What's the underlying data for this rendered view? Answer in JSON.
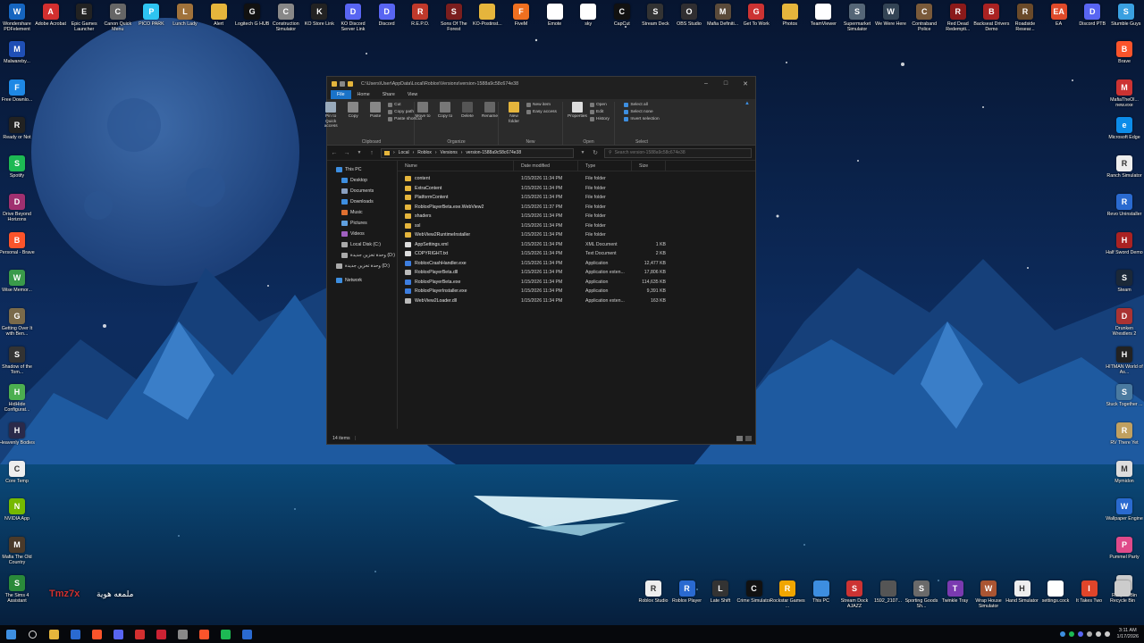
{
  "desktop_icons_top": [
    {
      "label": "Wondershare PDFelement",
      "color": "#1565c0",
      "glyph": "W"
    },
    {
      "label": "Adobe Acrobat",
      "color": "#d32f2f",
      "glyph": "A"
    },
    {
      "label": "Epic Games Launcher",
      "color": "#222222",
      "glyph": "E"
    },
    {
      "label": "Canon Quick Menu",
      "color": "#666666",
      "glyph": "C"
    },
    {
      "label": "PICO PARK",
      "color": "#2ec4f1",
      "glyph": "P"
    },
    {
      "label": "Lunch Lady",
      "color": "#a0723b",
      "glyph": "L"
    },
    {
      "label": "Alert",
      "color": "#e5b53c",
      "glyph": ""
    },
    {
      "label": "Logitech G HUB",
      "color": "#111111",
      "glyph": "G"
    },
    {
      "label": "Construction Simulator",
      "color": "#888888",
      "glyph": "C"
    },
    {
      "label": "KO Store Link",
      "color": "#222222",
      "glyph": "K"
    },
    {
      "label": "KO Discord Server Link",
      "color": "#5865f2",
      "glyph": "D"
    },
    {
      "label": "Discord",
      "color": "#5865f2",
      "glyph": "D"
    },
    {
      "label": "R.E.P.O.",
      "color": "#c0392b",
      "glyph": "R"
    },
    {
      "label": "Sons Of The Forest",
      "color": "#7b1e1e",
      "glyph": "S"
    },
    {
      "label": "KO-Postinst...",
      "color": "#e5b53c",
      "glyph": ""
    },
    {
      "label": "FiveM",
      "color": "#f07020",
      "glyph": "F"
    },
    {
      "label": "Emote",
      "color": "#ffffff",
      "glyph": ""
    },
    {
      "label": "sky",
      "color": "#ffffff",
      "glyph": ""
    },
    {
      "label": "CapCut",
      "color": "#111111",
      "glyph": "C"
    },
    {
      "label": "Stream Deck",
      "color": "#333333",
      "glyph": "S"
    },
    {
      "label": "OBS Studio",
      "color": "#302e31",
      "glyph": "O"
    },
    {
      "label": "Mafia Definiti...",
      "color": "#5a4a3a",
      "glyph": "M"
    },
    {
      "label": "Get To Work",
      "color": "#cc3333",
      "glyph": "G"
    },
    {
      "label": "Photos",
      "color": "#e5b53c",
      "glyph": ""
    },
    {
      "label": "TeamViewer",
      "color": "#ffffff",
      "glyph": ""
    },
    {
      "label": "Supermarket Simulator",
      "color": "#556677",
      "glyph": "S"
    },
    {
      "label": "We Were Here",
      "color": "#334455",
      "glyph": "W"
    },
    {
      "label": "Contraband Police",
      "color": "#7a5a3a",
      "glyph": "C"
    },
    {
      "label": "Red Dead Redempti...",
      "color": "#8b1a1a",
      "glyph": "R"
    },
    {
      "label": "Backseat Drivers Demo",
      "color": "#aa2222",
      "glyph": "B"
    },
    {
      "label": "Roadside Resear...",
      "color": "#6a4a2a",
      "glyph": "R"
    },
    {
      "label": "EA",
      "color": "#e04a2a",
      "glyph": "EA"
    },
    {
      "label": "Discord PTB",
      "color": "#5865f2",
      "glyph": "D"
    },
    {
      "label": "Stumble Guys",
      "color": "#3aa0e0",
      "glyph": "S"
    }
  ],
  "desktop_icons_left": [
    {
      "label": "Malwareby...",
      "color": "#1f4fb5",
      "glyph": "M"
    },
    {
      "label": "Free Downlo...",
      "color": "#1e88e5",
      "glyph": "F"
    },
    {
      "label": "Ready or Not",
      "color": "#222222",
      "glyph": "R"
    },
    {
      "label": "Spotify",
      "color": "#1db954",
      "glyph": "S"
    },
    {
      "label": "Drive Beyond Horizons",
      "color": "#a03070",
      "glyph": "D"
    },
    {
      "label": "Personal - Brave",
      "color": "#fb542b",
      "glyph": "B"
    },
    {
      "label": "Wise Memor...",
      "color": "#3a9a4a",
      "glyph": "W"
    },
    {
      "label": "Getting Over It with Ben...",
      "color": "#7a6a4a",
      "glyph": "G"
    },
    {
      "label": "Shadow of the Tom...",
      "color": "#333333",
      "glyph": "S"
    },
    {
      "label": "HidHide Configurat...",
      "color": "#4caf50",
      "glyph": "H"
    },
    {
      "label": "Heavenly Bodies",
      "color": "#2a2a4a",
      "glyph": "H"
    },
    {
      "label": "Core Temp",
      "color": "#eeeeee",
      "glyph": "C"
    },
    {
      "label": "NVIDIA App",
      "color": "#76b900",
      "glyph": "N"
    },
    {
      "label": "Mafia The Old Country",
      "color": "#4a3a2a",
      "glyph": "M"
    },
    {
      "label": "The Sims 4 Assistant",
      "color": "#2a8a3a",
      "glyph": "S"
    }
  ],
  "desktop_icons_right": [
    {
      "label": "Brave",
      "color": "#fb542b",
      "glyph": "B"
    },
    {
      "label": "MafiaTheOl... new.exe",
      "color": "#cc3333",
      "glyph": "M"
    },
    {
      "label": "Microsoft Edge",
      "color": "#0c8ce9",
      "glyph": "e"
    },
    {
      "label": "Ranch Simulator",
      "color": "#eeeeee",
      "glyph": "R"
    },
    {
      "label": "Revo Uninstaller",
      "color": "#2a6ad0",
      "glyph": "R"
    },
    {
      "label": "Half Sword Demo",
      "color": "#aa2222",
      "glyph": "H"
    },
    {
      "label": "Steam",
      "color": "#1b2838",
      "glyph": "S"
    },
    {
      "label": "Drunken Wrestlers 2",
      "color": "#aa3333",
      "glyph": "D"
    },
    {
      "label": "HITMAN World of As...",
      "color": "#222222",
      "glyph": "H"
    },
    {
      "label": "Stuck Together ...",
      "color": "#4a7aa0",
      "glyph": "S"
    },
    {
      "label": "RV There Yet",
      "color": "#c0a060",
      "glyph": "R"
    },
    {
      "label": "Mymidon",
      "color": "#dddddd",
      "glyph": "M"
    },
    {
      "label": "Wallpaper Engine",
      "color": "#2a6ad0",
      "glyph": "W"
    },
    {
      "label": "Pummel Party",
      "color": "#e04a8a",
      "glyph": "P"
    },
    {
      "label": "Recycle Bin",
      "color": "#cccccc",
      "glyph": ""
    }
  ],
  "desktop_icons_bottom": [
    {
      "label": "Roblox Studio",
      "color": "#eeeeee",
      "glyph": "R"
    },
    {
      "label": "Roblox Player",
      "color": "#2a6ad0",
      "glyph": "R"
    },
    {
      "label": "Late Shift",
      "color": "#333333",
      "glyph": "L"
    },
    {
      "label": "Crime Simulator",
      "color": "#111111",
      "glyph": "C"
    },
    {
      "label": "Rockstar Games ...",
      "color": "#f0a500",
      "glyph": "R"
    },
    {
      "label": "This PC",
      "color": "#3d8ee0",
      "glyph": ""
    },
    {
      "label": "Stream Dock AJAZZ",
      "color": "#cc3333",
      "glyph": "S"
    },
    {
      "label": "1592_2107...",
      "color": "#555555",
      "glyph": ""
    },
    {
      "label": "Sporting Goods Sh...",
      "color": "#6a6a6a",
      "glyph": "S"
    },
    {
      "label": "Twinkle Tray",
      "color": "#7a3ab0",
      "glyph": "T"
    },
    {
      "label": "Wrap House Simulator",
      "color": "#aa5533",
      "glyph": "W"
    },
    {
      "label": "Hand Simulator",
      "color": "#eeeeee",
      "glyph": "H"
    },
    {
      "label": "settings.cock",
      "color": "#ffffff",
      "glyph": ""
    },
    {
      "label": "It Takes Two",
      "color": "#e0452a",
      "glyph": "I"
    },
    {
      "label": "Recycle Bin",
      "color": "#cccccc",
      "glyph": ""
    }
  ],
  "overlay_text": {
    "arabic": "ملمعه هوية",
    "tag": "Tmz7x"
  },
  "explorer": {
    "title_path": "C:\\Users\\User\\AppData\\Local\\Roblox\\Versions\\version-1588a9c58c674e38",
    "tabs": [
      "File",
      "Home",
      "Share",
      "View"
    ],
    "ribbon": {
      "clipboard": {
        "name": "Clipboard",
        "pin": "Pin to Quick access",
        "copy": "Copy",
        "paste": "Paste",
        "cut": "Cut",
        "copy_path": "Copy path",
        "paste_shortcut": "Paste shortcut"
      },
      "organize": {
        "name": "Organize",
        "move": "Move to",
        "copy": "Copy to",
        "delete": "Delete",
        "rename": "Rename"
      },
      "new": {
        "name": "New",
        "folder": "New folder",
        "item": "New item",
        "easy": "Easy access"
      },
      "open": {
        "name": "Open",
        "properties": "Properties",
        "open": "Open",
        "edit": "Edit",
        "history": "History"
      },
      "select": {
        "name": "Select",
        "all": "Select all",
        "none": "Select none",
        "invert": "Invert selection"
      }
    },
    "breadcrumb": [
      "Local",
      "Roblox",
      "Versions",
      "version-1588a9c58c674e38"
    ],
    "search_placeholder": "Search version-1588a9c58c674e38",
    "nav": [
      {
        "label": "This PC",
        "color": "#3d8ee0"
      },
      {
        "label": "Desktop",
        "color": "#3d8ee0"
      },
      {
        "label": "Documents",
        "color": "#8aa0c0"
      },
      {
        "label": "Downloads",
        "color": "#3d8ee0"
      },
      {
        "label": "Music",
        "color": "#e07030"
      },
      {
        "label": "Pictures",
        "color": "#60a0e0"
      },
      {
        "label": "Videos",
        "color": "#a060c0"
      },
      {
        "label": "Local Disk (C:)",
        "color": "#aaaaaa"
      },
      {
        "label": "وحدة تخزين جديدة (D:)",
        "color": "#aaaaaa"
      },
      {
        "label": "وحدة تخزين جديدة (D:)",
        "color": "#aaaaaa"
      },
      {
        "label": "Network",
        "color": "#3d8ee0"
      }
    ],
    "columns": [
      "Name",
      "Date modified",
      "Type",
      "Size"
    ],
    "files": [
      {
        "name": "content",
        "date": "1/15/2026 11:34 PM",
        "type": "File folder",
        "size": "",
        "kind": "folder"
      },
      {
        "name": "ExtraContent",
        "date": "1/15/2026 11:34 PM",
        "type": "File folder",
        "size": "",
        "kind": "folder"
      },
      {
        "name": "PlatformContent",
        "date": "1/15/2026 11:34 PM",
        "type": "File folder",
        "size": "",
        "kind": "folder"
      },
      {
        "name": "RobloxPlayerBeta.exe.WebView2",
        "date": "1/15/2026 11:37 PM",
        "type": "File folder",
        "size": "",
        "kind": "folder"
      },
      {
        "name": "shaders",
        "date": "1/15/2026 11:34 PM",
        "type": "File folder",
        "size": "",
        "kind": "folder"
      },
      {
        "name": "ssl",
        "date": "1/15/2026 11:34 PM",
        "type": "File folder",
        "size": "",
        "kind": "folder"
      },
      {
        "name": "WebView2RuntimeInstaller",
        "date": "1/15/2026 11:34 PM",
        "type": "File folder",
        "size": "",
        "kind": "folder"
      },
      {
        "name": "AppSettings.xml",
        "date": "1/15/2026 11:34 PM",
        "type": "XML Document",
        "size": "1 KB",
        "kind": "doc"
      },
      {
        "name": "COPYRIGHT.txt",
        "date": "1/15/2026 11:34 PM",
        "type": "Text Document",
        "size": "2 KB",
        "kind": "doc"
      },
      {
        "name": "RobloxCrashHandler.exe",
        "date": "1/15/2026 11:34 PM",
        "type": "Application",
        "size": "12,477 KB",
        "kind": "app"
      },
      {
        "name": "RobloxPlayerBeta.dll",
        "date": "1/15/2026 11:34 PM",
        "type": "Application exten...",
        "size": "17,806 KB",
        "kind": "dll"
      },
      {
        "name": "RobloxPlayerBeta.exe",
        "date": "1/15/2026 11:34 PM",
        "type": "Application",
        "size": "114,635 KB",
        "kind": "app"
      },
      {
        "name": "RobloxPlayerInstaller.exe",
        "date": "1/15/2026 11:34 PM",
        "type": "Application",
        "size": "9,391 KB",
        "kind": "app"
      },
      {
        "name": "WebView2Loader.dll",
        "date": "1/15/2026 11:34 PM",
        "type": "Application exten...",
        "size": "163 KB",
        "kind": "dll"
      }
    ],
    "status": "14 items"
  },
  "taskbar": {
    "apps": [
      {
        "name": "start",
        "color": "#3d8ee0"
      },
      {
        "name": "search",
        "color": "#dddddd"
      },
      {
        "name": "file-explorer",
        "color": "#e5b53c"
      },
      {
        "name": "steam",
        "color": "#2a6ad0"
      },
      {
        "name": "brave",
        "color": "#fb542b"
      },
      {
        "name": "discord",
        "color": "#5865f2"
      },
      {
        "name": "adobe",
        "color": "#d32f2f"
      },
      {
        "name": "opera",
        "color": "#cc2233"
      },
      {
        "name": "obs",
        "color": "#888888"
      },
      {
        "name": "brave-2",
        "color": "#fb542b"
      },
      {
        "name": "spotify",
        "color": "#1db954"
      },
      {
        "name": "roblox",
        "color": "#2a6ad0"
      }
    ],
    "time": "3:11 AM",
    "date": "1/17/2026"
  }
}
